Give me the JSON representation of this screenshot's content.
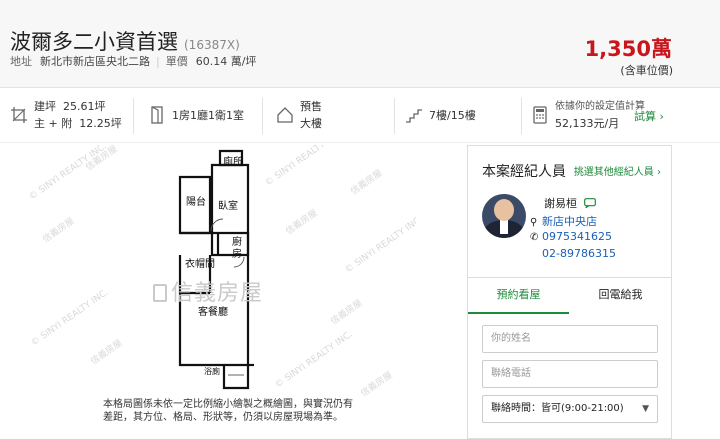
{
  "header": {
    "title": "波爾多二小資首選",
    "code": "(16387X)",
    "address_label": "地址",
    "address": "新北市新店區央北二路",
    "unit_price_label": "單價",
    "unit_price": "60.14 萬/坪",
    "price": "1,350萬",
    "price_note": "(含車位價)"
  },
  "specs": {
    "area_label_1": "建坪",
    "area_value_1": "25.61坪",
    "area_label_2": "主 + 附",
    "area_value_2": "12.25坪",
    "layout": "1房1廳1衛1室",
    "type_1": "預售",
    "type_2": "大樓",
    "floor": "7樓/15樓",
    "mortgage_label": "依據你的設定值計算",
    "mortgage_value": "52,133元/月",
    "trial": "試算 ›"
  },
  "plan": {
    "brand": "信義房屋",
    "watermark": "© SINYI REALTY INC.",
    "watermark_cn": "信義房屋",
    "rooms": {
      "toilet": "廁所",
      "balcony": "陽台",
      "bedroom": "臥室",
      "kitchen": "廚房",
      "closet": "衣帽間",
      "living": "客餐廳",
      "bath": "浴廁"
    },
    "note": "本格局圖係未依一定比例縮小繪製之概繪圖，與實況仍有差距，其方位、格局、形狀等，仍須以房屋現場為準。"
  },
  "agent": {
    "heading": "本案經紀人員",
    "more": "挑選其他經紀人員 ›",
    "name": "謝易桓",
    "store": "新店中央店",
    "phone1": "0975341625",
    "phone2": "02-89786315",
    "tab_visit": "預約看屋",
    "tab_call": "回電給我",
    "name_placeholder": "你的姓名",
    "phone_placeholder": "聯絡電話",
    "time_label": "聯絡時間：",
    "time_value": "皆可(9:00-21:00)"
  },
  "colors": {
    "price": "#c8161d",
    "accent": "#1e8a3c",
    "link": "#1a5fb4"
  }
}
